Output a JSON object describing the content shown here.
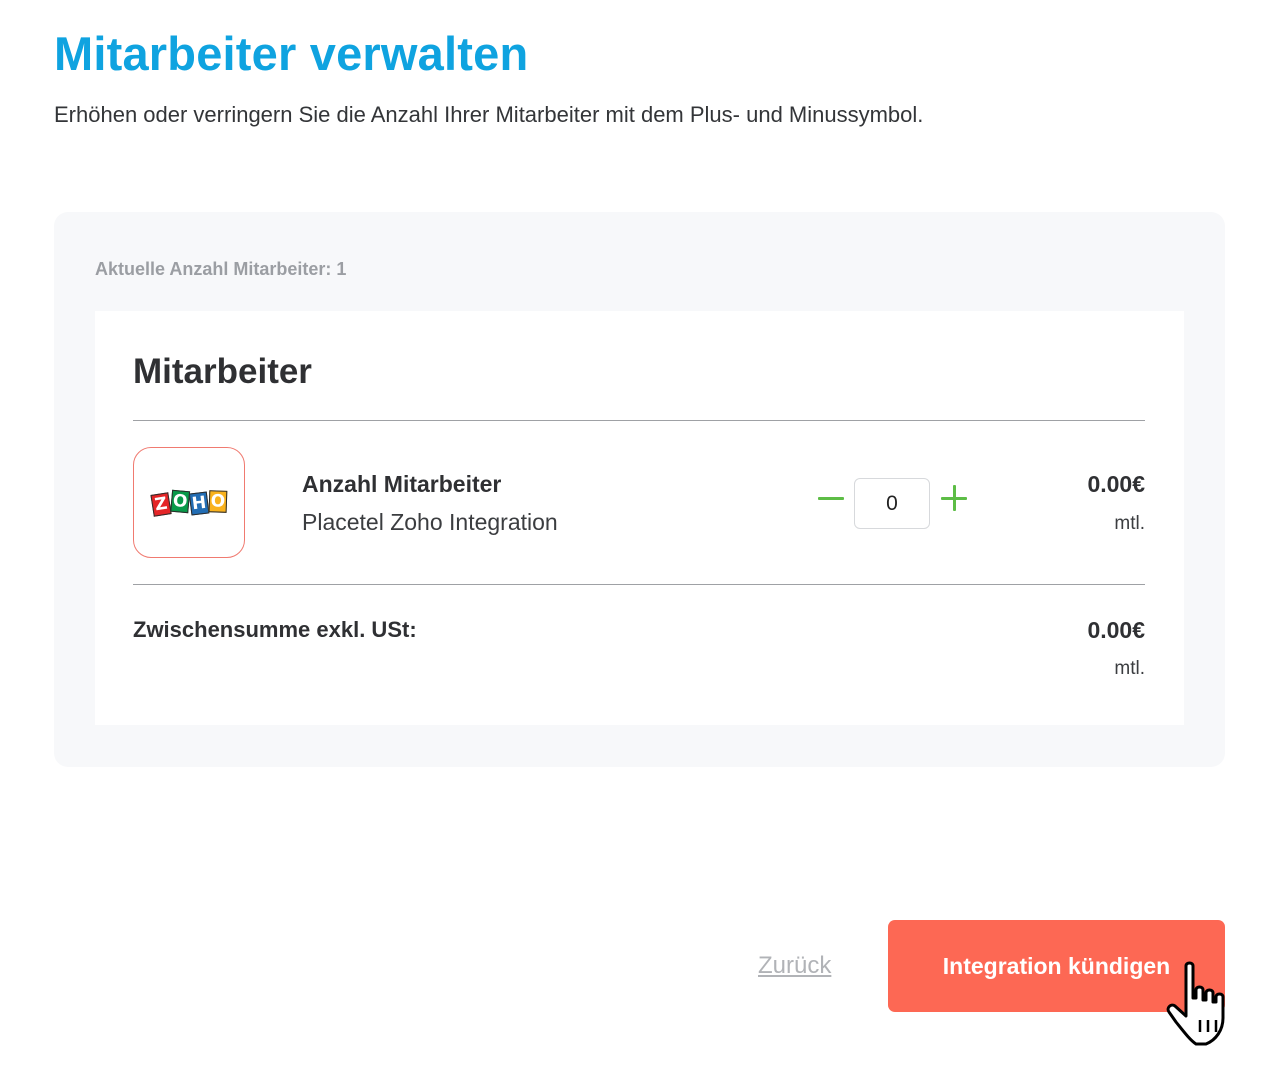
{
  "header": {
    "title": "Mitarbeiter verwalten",
    "subtitle": "Erhöhen oder verringern Sie die Anzahl Ihrer Mitarbeiter mit dem Plus- und Minussymbol."
  },
  "card": {
    "current_count_label": "Aktuelle Anzahl Mitarbeiter: 1",
    "section_title": "Mitarbeiter",
    "item": {
      "logo_text": "ZOHO",
      "logo_letters": [
        "Z",
        "O",
        "H",
        "O"
      ],
      "name": "Anzahl Mitarbeiter",
      "description": "Placetel Zoho Integration",
      "quantity": "0",
      "price": "0.00€",
      "period": "mtl."
    },
    "subtotal": {
      "label": "Zwischensumme exkl. USt:",
      "price": "0.00€",
      "period": "mtl."
    }
  },
  "actions": {
    "back_label": "Zurück",
    "cancel_label": "Integration kündigen"
  },
  "colors": {
    "title": "#0fa3e0",
    "stepper": "#5dbd46",
    "cancel_button": "#fd6854",
    "logo_border": "#f07a70"
  },
  "icons": {
    "minus": "minus-icon",
    "plus": "plus-icon",
    "cursor": "hand-pointer-icon"
  }
}
